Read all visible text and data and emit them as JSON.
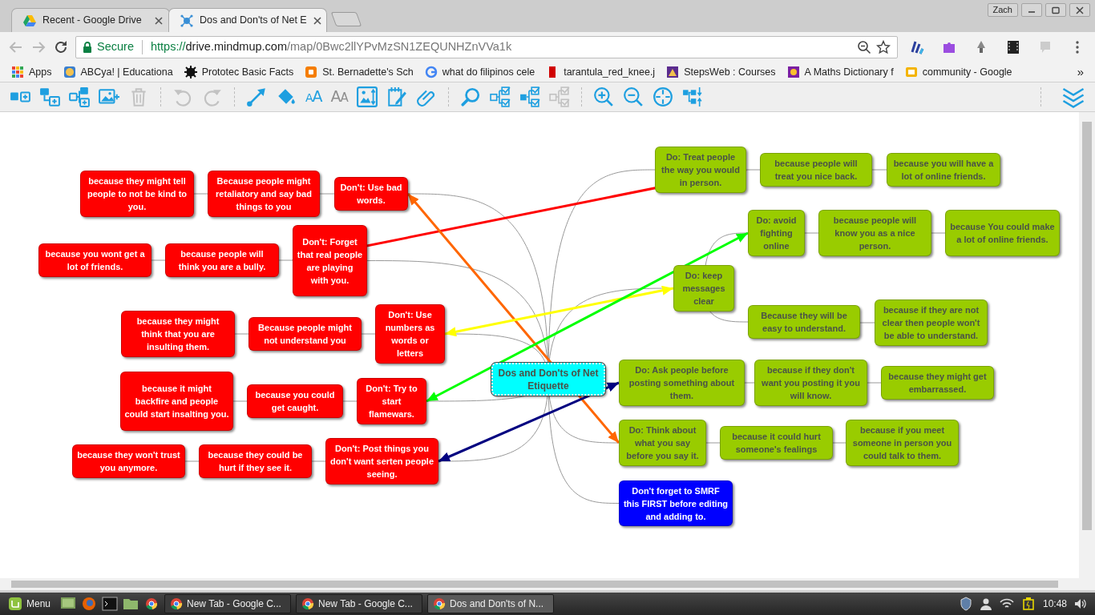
{
  "browser": {
    "tabs": [
      {
        "title": "Recent - Google Drive",
        "kind": "drive",
        "selected": false
      },
      {
        "title": "Dos and Don'ts of Net E",
        "kind": "mindmup",
        "selected": true
      }
    ],
    "profile": "Zach",
    "back": {
      "disabled": true
    },
    "forward": {
      "disabled": true
    },
    "address": {
      "secure_label": "Secure",
      "scheme": "https://",
      "host": "drive.mindmup.com",
      "path": "/map/0Bwc2llYPvMzSN1ZEQUNHZnVVa1k"
    },
    "bookmarks": [
      {
        "title": "Apps",
        "kind": "apps"
      },
      {
        "title": "ABCya! | Educationa",
        "kind": "abcya"
      },
      {
        "title": "Prototec Basic Facts",
        "kind": "gear"
      },
      {
        "title": "St. Bernadette's Sch",
        "kind": "blogger"
      },
      {
        "title": "what do filipinos cele",
        "kind": "google"
      },
      {
        "title": "tarantula_red_knee.j",
        "kind": "redfile"
      },
      {
        "title": "StepsWeb : Courses",
        "kind": "stepsweb"
      },
      {
        "title": "A Maths Dictionary f",
        "kind": "maths"
      },
      {
        "title": "community - Google",
        "kind": "slides"
      }
    ],
    "more_bookmarks": "»"
  },
  "toolbar": {
    "groups": [
      {
        "tools": [
          {
            "kind": "add-sibling",
            "disabled": false
          },
          {
            "kind": "add-child",
            "disabled": false
          },
          {
            "kind": "add-parent",
            "disabled": false
          },
          {
            "kind": "add-image",
            "disabled": false
          },
          {
            "kind": "delete",
            "disabled": true
          }
        ]
      },
      {
        "tools": [
          {
            "kind": "undo",
            "disabled": true
          },
          {
            "kind": "redo",
            "disabled": true
          }
        ]
      },
      {
        "tools": [
          {
            "kind": "connect",
            "disabled": false
          },
          {
            "kind": "fill",
            "disabled": false
          },
          {
            "kind": "font-grow",
            "glyph": "AA",
            "disabled": false
          },
          {
            "kind": "font-shrink",
            "glyph": "AA",
            "disabled": true
          },
          {
            "kind": "image-size",
            "disabled": false
          },
          {
            "kind": "note",
            "disabled": false
          },
          {
            "kind": "link",
            "disabled": false
          }
        ]
      },
      {
        "tools": [
          {
            "kind": "search",
            "disabled": false
          },
          {
            "kind": "select-tree",
            "disabled": false
          },
          {
            "kind": "select-children",
            "disabled": false
          },
          {
            "kind": "select-none",
            "disabled": true
          }
        ]
      },
      {
        "tools": [
          {
            "kind": "zoom-in",
            "disabled": false
          },
          {
            "kind": "zoom-out",
            "disabled": false
          },
          {
            "kind": "center",
            "disabled": false
          },
          {
            "kind": "arrange",
            "disabled": false
          }
        ]
      }
    ],
    "end_tools": [
      {
        "kind": "collapse",
        "disabled": false
      }
    ]
  },
  "map": {
    "root": {
      "text": "Dos and Don'ts of Net Etiquette",
      "color": "#00ffff",
      "children": [
        {
          "text": "Do: Treat people the way you would in person.",
          "color": "#99cc00",
          "children": [
            {
              "text": "because people will treat you nice back.",
              "color": "#99cc00",
              "children": [
                {
                  "text": "because you will have a lot of online friends.",
                  "color": "#99cc00"
                }
              ]
            }
          ]
        },
        {
          "text": "Don't: Use bad words.",
          "color": "#ff0000",
          "children": [
            {
              "text": "Because people might retaliatory and say bad things to you",
              "color": "#ff0000",
              "children": [
                {
                  "text": "because they might tell people to not be kind to you.",
                  "color": "#ff0000"
                }
              ]
            }
          ]
        },
        {
          "text": "Don't: Forget that real people are playing with you.",
          "color": "#ff0000",
          "children": [
            {
              "text": "because people will think you are a bully.",
              "color": "#ff0000",
              "children": [
                {
                  "text": "because you wont get a lot of friends.",
                  "color": "#ff0000"
                }
              ]
            }
          ]
        },
        {
          "text": "Do: keep messages clear",
          "color": "#99cc00",
          "children": [
            {
              "text": "Do: avoid fighting online",
              "color": "#99cc00",
              "children": [
                {
                  "text": "because people will know you as a nice person.",
                  "color": "#99cc00",
                  "children": [
                    {
                      "text": "because You could make a lot of online friends.",
                      "color": "#99cc00"
                    }
                  ]
                }
              ]
            },
            {
              "text": "Because they will be easy to understand.",
              "color": "#99cc00",
              "children": [
                {
                  "text": "because if they are not clear then people won't be able to understand.",
                  "color": "#99cc00"
                }
              ]
            }
          ]
        },
        {
          "text": "Don't: Use numbers as words or letters",
          "color": "#ff0000",
          "children": [
            {
              "text": "Because people might not understand you",
              "color": "#ff0000",
              "children": [
                {
                  "text": "because they might think that you are insulting them.",
                  "color": "#ff0000"
                }
              ]
            }
          ]
        },
        {
          "text": "Don't: Try to start flamewars.",
          "color": "#ff0000",
          "children": [
            {
              "text": "because you could get caught.",
              "color": "#ff0000",
              "children": [
                {
                  "text": "because it might backfire and people could start insalting you.",
                  "color": "#ff0000"
                }
              ]
            }
          ]
        },
        {
          "text": "Do: Ask people before posting something about them.",
          "color": "#99cc00",
          "children": [
            {
              "text": "because if they don't want you posting it you will know.",
              "color": "#99cc00",
              "children": [
                {
                  "text": "because they might get embarrassed.",
                  "color": "#99cc00"
                }
              ]
            }
          ]
        },
        {
          "text": "Do: Think about what you say before you say it.",
          "color": "#99cc00",
          "children": [
            {
              "text": "because it could hurt someone's fealings",
              "color": "#99cc00",
              "children": [
                {
                  "text": "because if you meet someone in person you could talk to them.",
                  "color": "#99cc00"
                }
              ]
            }
          ]
        },
        {
          "text": "Don't: Post things you don't want serten people seeing.",
          "color": "#ff0000",
          "children": [
            {
              "text": "because they could be hurt if they see it.",
              "color": "#ff0000",
              "children": [
                {
                  "text": "because they won't trust you anymore.",
                  "color": "#ff0000"
                }
              ]
            }
          ]
        },
        {
          "text": "Don't forget to SMRF this FIRST before editing and adding to.",
          "color": "#0000ff"
        }
      ]
    },
    "links": [
      {
        "color": "#ff0000"
      },
      {
        "color": "#ff6600"
      },
      {
        "color": "#ffff00"
      },
      {
        "color": "#00ff00"
      },
      {
        "color": "#000080"
      }
    ]
  },
  "taskbar": {
    "menu_label": "Menu",
    "windows": [
      {
        "title": "New Tab - Google C...",
        "selected": false
      },
      {
        "title": "New Tab - Google C...",
        "selected": false
      },
      {
        "title": "Dos and Don'ts of N...",
        "selected": true
      }
    ],
    "clock": "10:48"
  }
}
